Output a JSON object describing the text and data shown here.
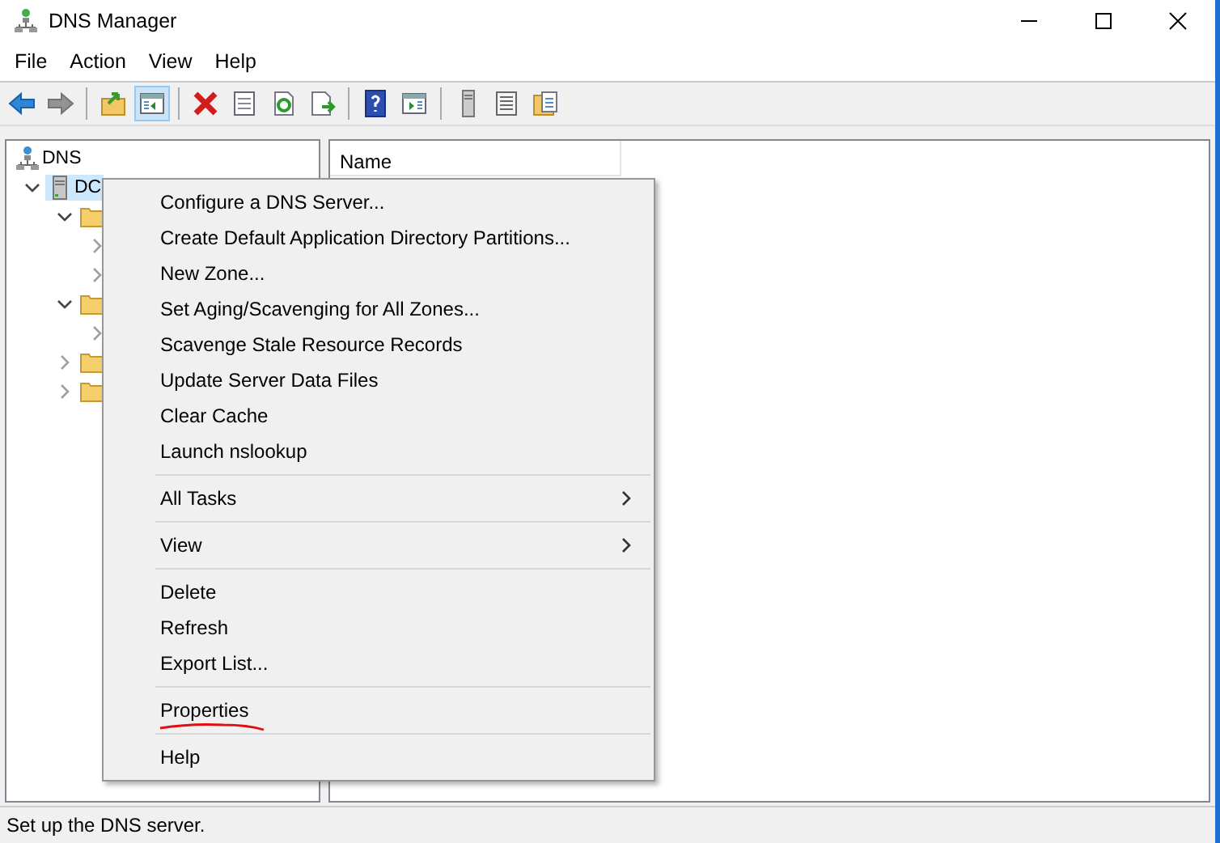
{
  "window": {
    "title": "DNS Manager"
  },
  "menu_bar": [
    "File",
    "Action",
    "View",
    "Help"
  ],
  "toolbar": [
    {
      "kind": "back",
      "disabled": false,
      "selected": false
    },
    {
      "kind": "forward",
      "disabled": true,
      "selected": false
    },
    {
      "kind": "separator"
    },
    {
      "kind": "up",
      "disabled": false,
      "selected": false
    },
    {
      "kind": "tree",
      "disabled": false,
      "selected": true
    },
    {
      "kind": "separator"
    },
    {
      "kind": "delete",
      "disabled": false,
      "selected": false
    },
    {
      "kind": "properties",
      "disabled": false,
      "selected": false
    },
    {
      "kind": "refresh",
      "disabled": false,
      "selected": false
    },
    {
      "kind": "export",
      "disabled": false,
      "selected": false
    },
    {
      "kind": "separator"
    },
    {
      "kind": "help",
      "disabled": false,
      "selected": false
    },
    {
      "kind": "action-pane",
      "disabled": false,
      "selected": false
    },
    {
      "kind": "separator"
    },
    {
      "kind": "server",
      "disabled": false,
      "selected": false
    },
    {
      "kind": "list",
      "disabled": false,
      "selected": false
    },
    {
      "kind": "zone",
      "disabled": false,
      "selected": false
    }
  ],
  "tree": [
    {
      "kind": "root",
      "label": "DNS",
      "selected": false,
      "children": [
        {
          "kind": "server",
          "label": "DC",
          "selected": true,
          "expanded": true,
          "children": [
            {
              "kind": "folder",
              "expanded": true,
              "selected": false,
              "children": [
                {
                  "expanded": false
                },
                {
                  "expanded": false
                }
              ]
            },
            {
              "kind": "folder",
              "expanded": true,
              "selected": false,
              "children": [
                {
                  "expanded": false
                }
              ]
            },
            {
              "kind": "folder",
              "expanded": false,
              "selected": false
            },
            {
              "kind": "folder",
              "expanded": false,
              "selected": false
            }
          ]
        }
      ]
    }
  ],
  "list": {
    "columns": [
      "Name"
    ]
  },
  "context_menu": [
    {
      "kind": "item",
      "label": "Configure a DNS Server..."
    },
    {
      "kind": "item",
      "label": "Create Default Application Directory Partitions..."
    },
    {
      "kind": "item",
      "label": "New Zone..."
    },
    {
      "kind": "item",
      "label": "Set Aging/Scavenging for All Zones..."
    },
    {
      "kind": "item",
      "label": "Scavenge Stale Resource Records"
    },
    {
      "kind": "item",
      "label": "Update Server Data Files"
    },
    {
      "kind": "item",
      "label": "Clear Cache"
    },
    {
      "kind": "item",
      "label": "Launch nslookup"
    },
    {
      "kind": "separator"
    },
    {
      "kind": "submenu",
      "label": "All Tasks"
    },
    {
      "kind": "separator"
    },
    {
      "kind": "submenu",
      "label": "View"
    },
    {
      "kind": "separator"
    },
    {
      "kind": "item",
      "label": "Delete"
    },
    {
      "kind": "item",
      "label": "Refresh"
    },
    {
      "kind": "item",
      "label": "Export List..."
    },
    {
      "kind": "separator"
    },
    {
      "kind": "item",
      "label": "Properties",
      "underlined": true
    },
    {
      "kind": "separator"
    },
    {
      "kind": "item",
      "label": "Help"
    }
  ],
  "status_bar": "Set up the DNS server."
}
